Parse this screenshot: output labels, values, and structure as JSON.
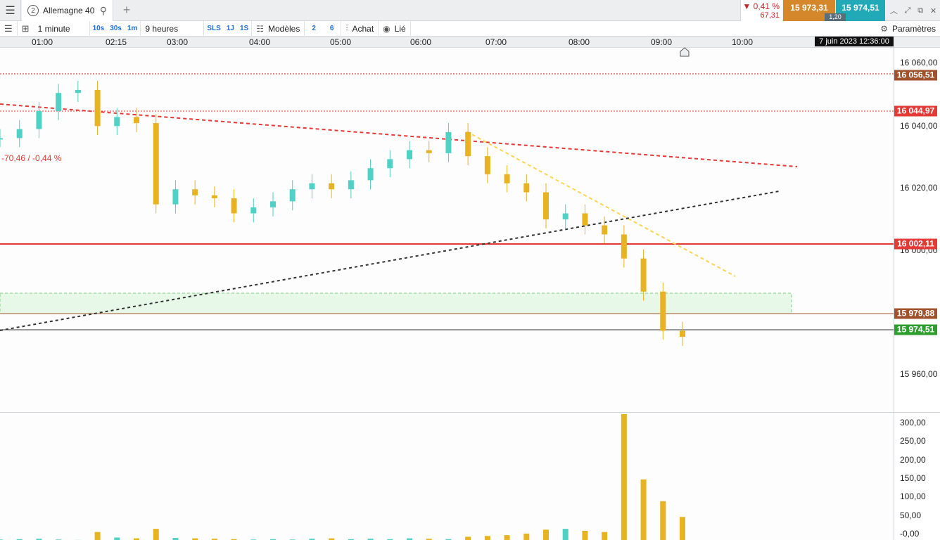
{
  "tab": {
    "number": "2",
    "name": "Allemagne 40"
  },
  "quote": {
    "change_pct": "0,41 %",
    "change_abs": "67,31",
    "bid": "15 973,31",
    "ask": "15 974,51",
    "spread": "1,20"
  },
  "toolbar": {
    "interval": "1 minute",
    "quick_intervals": [
      "10s",
      "30s",
      "1m"
    ],
    "duration": "9 heures",
    "quick_ranges": [
      "SLS",
      "1J",
      "1S"
    ],
    "models_label": "Modèles",
    "layout_buttons": [
      "2",
      "6"
    ],
    "buy_label": "Achat",
    "linked_label": "Lié",
    "settings_label": "Paramètres"
  },
  "time_axis": {
    "labels": [
      "01:00",
      "02:15",
      "03:00",
      "04:00",
      "05:00",
      "06:00",
      "07:00",
      "08:00",
      "09:00",
      "10:00"
    ],
    "date_label": "7 juin 2023 12:36:00"
  },
  "price_axis": {
    "labels": [
      "16 060,00",
      "16 040,00",
      "16 020,00",
      "16 000,00",
      "15 960,00"
    ]
  },
  "price_tags": [
    {
      "value": "16 056,51",
      "color": "#a0522d"
    },
    {
      "value": "16 044,97",
      "color": "#e53935"
    },
    {
      "value": "16 002,11",
      "color": "#e53935"
    },
    {
      "value": "15 979,88",
      "color": "#a0522d"
    },
    {
      "value": "15 974,51",
      "color": "#2e9e2e"
    }
  ],
  "annotation": "-70,46 / -0,44 %",
  "volume_axis": {
    "labels": [
      "300,00",
      "250,00",
      "200,00",
      "150,00",
      "100,00",
      "50,00",
      "-0,00"
    ]
  },
  "colors": {
    "up": "#4fd1c5",
    "down": "#e8b321",
    "resistance": "#e53935",
    "trend_down": "#ffd54f",
    "trend_up": "#333333",
    "zone": "#e8f8e8"
  },
  "chart_data": {
    "type": "candlestick",
    "x": [
      "01:00",
      "01:15",
      "01:30",
      "01:45",
      "02:00",
      "02:15",
      "02:30",
      "02:45",
      "03:00",
      "03:15",
      "03:30",
      "03:45",
      "04:00",
      "04:15",
      "04:30",
      "04:45",
      "05:00",
      "05:15",
      "05:30",
      "05:45",
      "06:00",
      "06:15",
      "06:30",
      "06:45",
      "07:00",
      "07:15",
      "07:30",
      "07:45",
      "08:00",
      "08:15",
      "08:30",
      "08:45",
      "09:00",
      "09:10",
      "09:20",
      "09:30"
    ],
    "close": [
      16036,
      16039,
      16045,
      16051,
      16052,
      16040,
      16043,
      16041,
      16014,
      16019,
      16017,
      16016,
      16011,
      16013,
      16015,
      16019,
      16021,
      16019,
      16022,
      16026,
      16029,
      16032,
      16031,
      16038,
      16030,
      16024,
      16021,
      16018,
      16009,
      16011,
      16007,
      16004,
      15996,
      15985,
      15972,
      15970
    ],
    "volume": [
      3,
      4,
      5,
      3,
      2,
      22,
      8,
      6,
      30,
      7,
      6,
      5,
      4,
      3,
      4,
      3,
      5,
      6,
      4,
      5,
      4,
      6,
      5,
      4,
      10,
      12,
      14,
      18,
      28,
      30,
      25,
      22,
      320,
      155,
      100,
      60
    ],
    "horizontal_lines": [
      16056.51,
      16044.97,
      16002.11,
      15979.88,
      15974.51
    ],
    "y_range": [
      15945,
      16066
    ],
    "volume_range": [
      0,
      320
    ]
  }
}
